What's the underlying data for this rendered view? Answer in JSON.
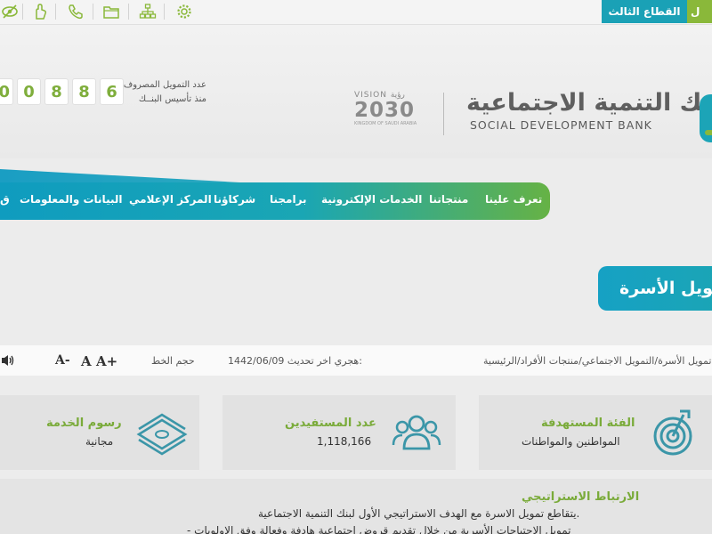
{
  "topbar": {
    "tabs": {
      "third_sector": "القطاع الثالث",
      "partial": "ل"
    },
    "icons": [
      "accessibility-icon",
      "hand-icon",
      "phone-icon",
      "folder-icon",
      "sitemap-icon",
      "gear-icon"
    ]
  },
  "header": {
    "funding_digits": [
      "6",
      "8",
      "8",
      "0",
      "0"
    ],
    "funding_label_line1": "عدد التمويل المصروف",
    "funding_label_line2": "منذ تأسيس البنــك",
    "vision_top": "VISION رؤية",
    "vision_year": "2030",
    "vision_sub": "KINGDOM OF SAUDI ARABIA",
    "bank_name_ar": "بنك التنمية الاجتماعية",
    "bank_name_en": "SOCIAL DEVELOPMENT BANK"
  },
  "nav": {
    "items": [
      "تعرف علينا",
      "منتجاتنا",
      "الخدمات الإلكترونية",
      "برامجنا",
      "شركاؤنا",
      "المركز الإعلامي",
      "البيانات والمعلومات",
      "ق"
    ]
  },
  "page": {
    "title": "تمويل الأسرة"
  },
  "infobar": {
    "font_size_label": "حجم الخط",
    "font_sizes": [
      "A+",
      "A",
      "A-"
    ],
    "last_update_label": "اخر تحديث:",
    "last_update_value": "1442/06/09 هجري",
    "breadcrumb": [
      "الرئيسية",
      "منتجات الأفراد",
      "التمويل الاجتماعي",
      "تمويل الأسرة"
    ]
  },
  "cards": [
    {
      "title": "الفئة المستهدفة",
      "value": "المواطنين والمواطنات",
      "icon": "target-icon"
    },
    {
      "title": "عدد المستفيدين",
      "value": "1,118,166",
      "icon": "users-icon"
    },
    {
      "title": "رسوم الخدمة",
      "value": "مجانية",
      "icon": "money-icon"
    }
  ],
  "strategy": {
    "title": "الارتباط الاستراتيجي",
    "line1": "يتقاطع تمويل الاسرة مع الهدف الاستراتيجي الأول لبنك التنمية الاجتماعية.",
    "line2": "- تمويل الاحتياجات الأسرية من خلال تقديم قروض اجتماعية هادفة وفعالة وفق الاولويات"
  },
  "colors": {
    "teal": "#1aa1b6",
    "green": "#8ab83a",
    "title_green": "#7aab3a"
  }
}
